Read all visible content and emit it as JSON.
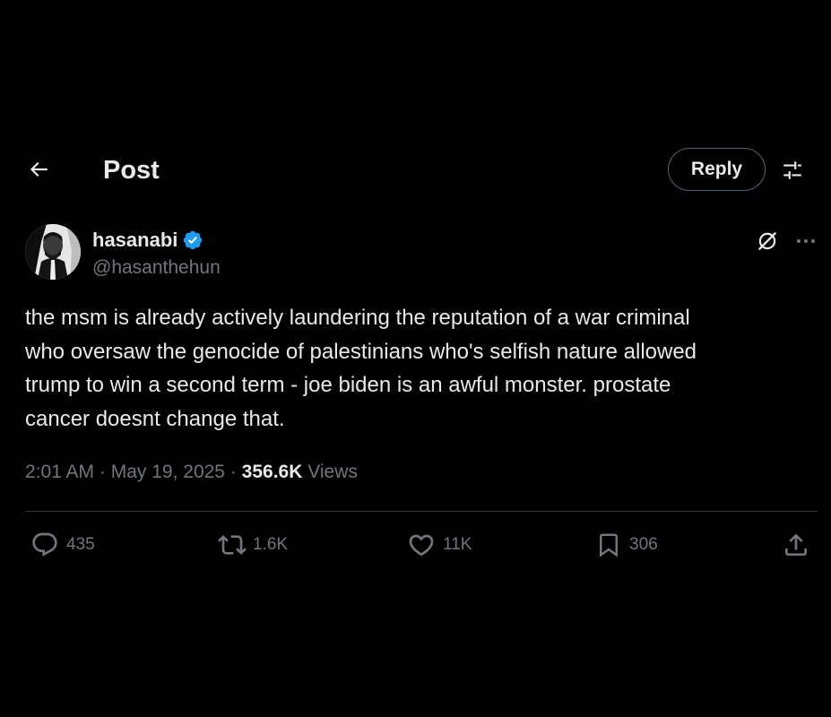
{
  "header": {
    "title": "Post",
    "reply_label": "Reply"
  },
  "author": {
    "display_name": "hasanabi",
    "handle": "@hasanthehun",
    "verified": true
  },
  "post": {
    "lines": [
      "the msm is already actively laundering the reputation of a war criminal",
      "who oversaw the genocide of palestinians who's selfish nature allowed",
      "trump to win a second term - joe biden is an awful monster. prostate",
      "cancer doesnt change that."
    ],
    "time": "2:01 AM",
    "sep1": " · ",
    "date": "May 19, 2025",
    "sep2": " · ",
    "views": "356.6K",
    "views_label": " Views"
  },
  "actions": {
    "replies": "435",
    "reposts": "1.6K",
    "likes": "11K",
    "bookmarks": "306"
  },
  "icons": {
    "back": "arrow-left-icon",
    "filter": "sliders-icon",
    "verified": "verified-badge-icon",
    "grok": "grok-icon",
    "more": "ellipsis-icon",
    "reply": "comment-icon",
    "repost": "repost-icon",
    "like": "heart-icon",
    "bookmark": "bookmark-icon",
    "share": "share-icon"
  },
  "colors": {
    "background": "#000000",
    "text": "#e7e9ea",
    "muted": "#71767b",
    "verified": "#1d9bf0",
    "border": "#2f3336"
  }
}
